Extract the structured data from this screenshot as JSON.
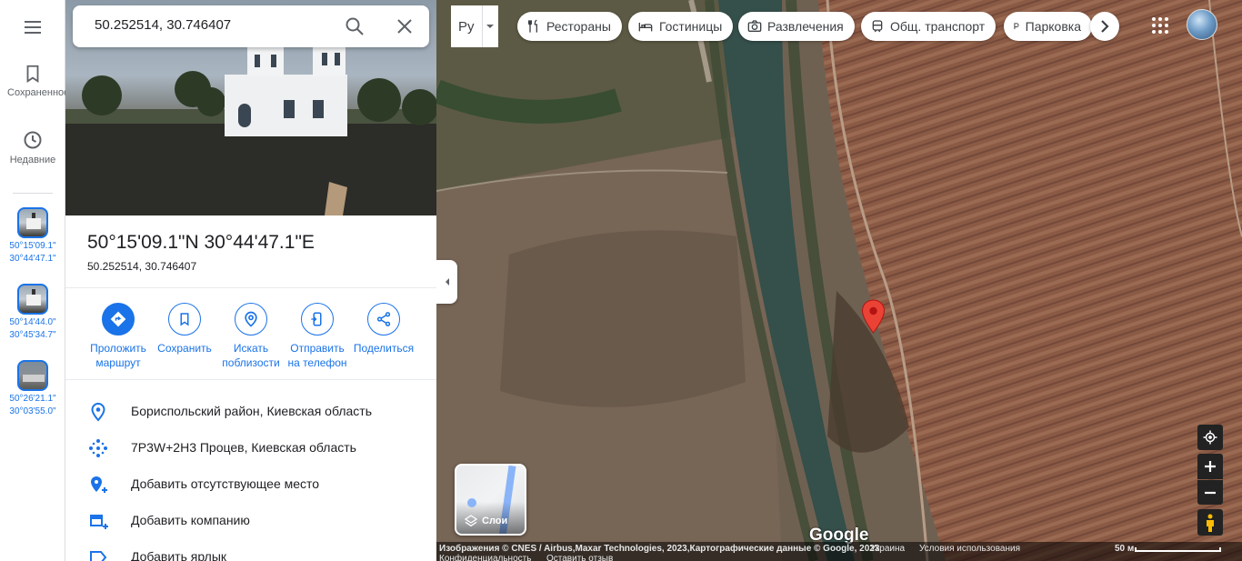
{
  "search": {
    "value": "50.252514, 30.746407"
  },
  "rail": {
    "saved_label": "Сохраненное",
    "recent_label": "Недавние",
    "recents": [
      {
        "lat": "50°15'09.1\"",
        "lng": "30°44'47.1\""
      },
      {
        "lat": "50°14'44.0\"",
        "lng": "30°45'34.7\""
      },
      {
        "lat": "50°26'21.1\"",
        "lng": "30°03'55.0\""
      }
    ]
  },
  "place": {
    "title": "50°15'09.1\"N 30°44'47.1\"E",
    "coords": "50.252514, 30.746407"
  },
  "actions": [
    {
      "label": "Проложить маршрут",
      "icon": "directions-icon"
    },
    {
      "label": "Сохранить",
      "icon": "bookmark-icon"
    },
    {
      "label": "Искать поблизости",
      "icon": "nearby-icon"
    },
    {
      "label": "Отправить на телефон",
      "icon": "phone-icon"
    },
    {
      "label": "Поделиться",
      "icon": "share-icon"
    }
  ],
  "info": [
    {
      "text": "Бориспольский район, Киевская область",
      "icon": "location-pin-icon"
    },
    {
      "text": "7P3W+2H3 Процев, Киевская область",
      "icon": "plus-code-icon"
    },
    {
      "text": "Добавить отсутствующее место",
      "icon": "add-place-icon"
    },
    {
      "text": "Добавить компанию",
      "icon": "add-business-icon"
    },
    {
      "text": "Добавить ярлык",
      "icon": "label-icon"
    }
  ],
  "map": {
    "lang_label": "Ру",
    "chips": [
      {
        "label": "Рестораны",
        "icon": "restaurant-icon"
      },
      {
        "label": "Гостиницы",
        "icon": "hotel-icon"
      },
      {
        "label": "Развлечения",
        "icon": "camera-icon"
      },
      {
        "label": "Общ. транспорт",
        "icon": "transit-icon"
      },
      {
        "label": "Парковка",
        "icon": "parking-icon"
      }
    ],
    "layers_label": "Слои",
    "google_logo": "Google",
    "attribution": "Изображения © CNES / Airbus,Maxar Technologies, 2023,Картографические данные © Google, 2023",
    "country": "Украина",
    "terms": "Условия использования",
    "privacy": "Конфиденциальность",
    "feedback": "Оставить отзыв",
    "scale": "50 м",
    "pin_color": "#ea4335"
  }
}
